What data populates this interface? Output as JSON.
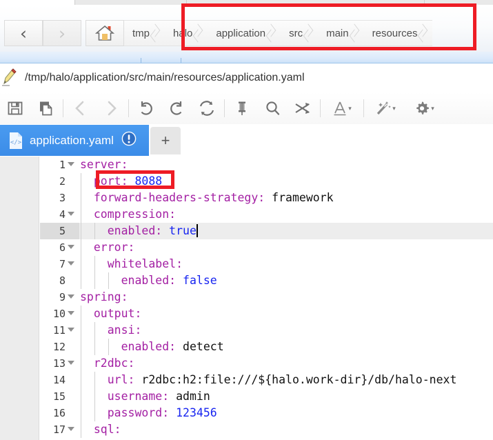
{
  "window": {
    "top_tab_stubs": 3
  },
  "explorer": {
    "back_icon": "chevron-left-icon",
    "back_label": "‹",
    "forward_icon": "chevron-right-icon",
    "forward_label": "›",
    "home_icon": "home-icon",
    "breadcrumbs": [
      {
        "label": "tmp"
      },
      {
        "label": "halo"
      },
      {
        "label": "application"
      },
      {
        "label": "src"
      },
      {
        "label": "main"
      },
      {
        "label": "resources"
      }
    ]
  },
  "path_bar": {
    "icon": "pencil-edit-icon",
    "path": "/tmp/halo/application/src/main/resources/application.yaml"
  },
  "toolbar": {
    "items": [
      {
        "name": "save-button",
        "icon": "save-floppy-icon",
        "enabled": true
      },
      {
        "name": "copy-button",
        "icon": "copy-pages-icon",
        "enabled": true
      },
      {
        "name": "back-button",
        "icon": "chevron-left-icon",
        "enabled": false
      },
      {
        "name": "forward-button",
        "icon": "chevron-right-icon",
        "enabled": false
      },
      {
        "name": "undo-button",
        "icon": "undo-arrow-icon",
        "enabled": true
      },
      {
        "name": "redo-button",
        "icon": "redo-arrow-icon",
        "enabled": true
      },
      {
        "name": "reload-button",
        "icon": "refresh-sync-icon",
        "enabled": true
      },
      {
        "name": "pin-button",
        "icon": "pin-icon",
        "enabled": true
      },
      {
        "name": "find-button",
        "icon": "search-magnifier-icon",
        "enabled": true
      },
      {
        "name": "shuffle-button",
        "icon": "shuffle-arrows-icon",
        "enabled": true
      },
      {
        "name": "font-menu-button",
        "icon": "font-letter-a-icon",
        "caret": "▾",
        "enabled": true
      },
      {
        "name": "magic-wand-menu-button",
        "icon": "magic-wand-icon",
        "caret": "▾",
        "enabled": true
      },
      {
        "name": "settings-menu-button",
        "icon": "gear-icon",
        "caret": "▾",
        "enabled": true
      }
    ]
  },
  "tabs": {
    "active_index": 0,
    "items": [
      {
        "label": "application.yaml",
        "file_icon": "code-file-icon",
        "status_icon": "warning-exclamation-icon",
        "active": true
      }
    ],
    "new_tab_label": "+",
    "new_tab_icon": "plus-icon"
  },
  "editor": {
    "current_line": 5,
    "accent_color": "#3b8ce8",
    "key_color": "#a31fa3",
    "value_color": "#1724f0",
    "string_color": "#111111",
    "lines": [
      {
        "n": "1",
        "fold": true,
        "indent": 0,
        "key": "server",
        "sep": ":",
        "value": "",
        "vtype": "none"
      },
      {
        "n": "2",
        "fold": false,
        "indent": 1,
        "key": "port",
        "sep": ":",
        "value": "8088",
        "vtype": "num"
      },
      {
        "n": "3",
        "fold": false,
        "indent": 1,
        "key": "forward-headers-strategy",
        "sep": ":",
        "value": "framework",
        "vtype": "str"
      },
      {
        "n": "4",
        "fold": true,
        "indent": 1,
        "key": "compression",
        "sep": ":",
        "value": "",
        "vtype": "none"
      },
      {
        "n": "5",
        "fold": false,
        "indent": 2,
        "key": "enabled",
        "sep": ":",
        "value": "true",
        "vtype": "bool"
      },
      {
        "n": "6",
        "fold": true,
        "indent": 1,
        "key": "error",
        "sep": ":",
        "value": "",
        "vtype": "none"
      },
      {
        "n": "7",
        "fold": true,
        "indent": 2,
        "key": "whitelabel",
        "sep": ":",
        "value": "",
        "vtype": "none"
      },
      {
        "n": "8",
        "fold": false,
        "indent": 3,
        "key": "enabled",
        "sep": ":",
        "value": "false",
        "vtype": "bool"
      },
      {
        "n": "9",
        "fold": true,
        "indent": 0,
        "key": "spring",
        "sep": ":",
        "value": "",
        "vtype": "none"
      },
      {
        "n": "10",
        "fold": true,
        "indent": 1,
        "key": "output",
        "sep": ":",
        "value": "",
        "vtype": "none"
      },
      {
        "n": "11",
        "fold": true,
        "indent": 2,
        "key": "ansi",
        "sep": ":",
        "value": "",
        "vtype": "none"
      },
      {
        "n": "12",
        "fold": false,
        "indent": 3,
        "key": "enabled",
        "sep": ":",
        "value": "detect",
        "vtype": "str"
      },
      {
        "n": "13",
        "fold": true,
        "indent": 1,
        "key": "r2dbc",
        "sep": ":",
        "value": "",
        "vtype": "none"
      },
      {
        "n": "14",
        "fold": false,
        "indent": 2,
        "key": "url",
        "sep": ":",
        "value": "r2dbc:h2:file:///${halo.work-dir}/db/halo-next",
        "vtype": "str"
      },
      {
        "n": "15",
        "fold": false,
        "indent": 2,
        "key": "username",
        "sep": ":",
        "value": "admin",
        "vtype": "str"
      },
      {
        "n": "16",
        "fold": false,
        "indent": 2,
        "key": "password",
        "sep": ":",
        "value": "123456",
        "vtype": "num"
      },
      {
        "n": "17",
        "fold": true,
        "indent": 1,
        "key": "sql",
        "sep": ":",
        "value": "",
        "vtype": "none"
      }
    ]
  },
  "annotations": {
    "color": "#ee1c25",
    "boxes": [
      {
        "name": "breadcrumb-highlight",
        "target": "breadcrumbs halo → resources"
      },
      {
        "name": "port-value-highlight",
        "target": "port: 8088"
      }
    ]
  }
}
